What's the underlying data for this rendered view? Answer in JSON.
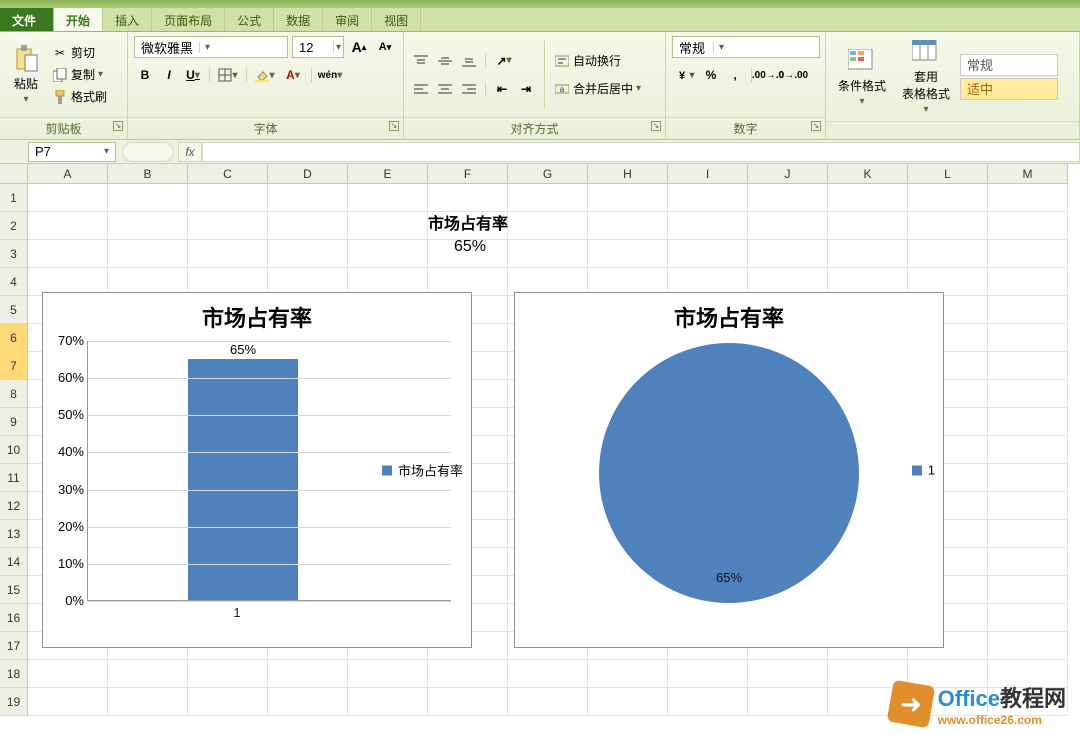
{
  "tabs": {
    "file": "文件",
    "home": "开始",
    "insert": "插入",
    "layout": "页面布局",
    "formula": "公式",
    "data": "数据",
    "review": "审阅",
    "view": "视图"
  },
  "ribbon": {
    "clipboard": {
      "paste": "粘贴",
      "cut": "剪切",
      "copy": "复制",
      "brush": "格式刷",
      "label": "剪贴板"
    },
    "font": {
      "name": "微软雅黑",
      "size": "12",
      "label": "字体"
    },
    "align": {
      "wrap": "自动换行",
      "merge": "合并后居中",
      "label": "对齐方式"
    },
    "number": {
      "format": "常规",
      "label": "数字"
    },
    "styles": {
      "cond": "条件格式",
      "table": "套用\n表格格式",
      "normal": "常规",
      "yellow": "适中"
    }
  },
  "namebox": "P7",
  "columns": [
    "A",
    "B",
    "C",
    "D",
    "E",
    "F",
    "G",
    "H",
    "I",
    "J",
    "K",
    "L",
    "M"
  ],
  "rows": [
    "1",
    "2",
    "3",
    "4",
    "5",
    "6",
    "7",
    "8",
    "9",
    "10",
    "11",
    "12",
    "13",
    "14",
    "15",
    "16",
    "17",
    "18",
    "19"
  ],
  "selected_rows": [
    6,
    7
  ],
  "celltext": {
    "title": "市场占有率",
    "value": "65%"
  },
  "chart_data": [
    {
      "type": "bar",
      "title": "市场占有率",
      "categories": [
        "1"
      ],
      "values": [
        65
      ],
      "ylabel": "",
      "ylim": [
        0,
        70
      ],
      "yticks": [
        0,
        10,
        20,
        30,
        40,
        50,
        60,
        70
      ],
      "data_labels": [
        "65%"
      ],
      "legend": [
        "市场占有率"
      ]
    },
    {
      "type": "pie",
      "title": "市场占有率",
      "series": [
        {
          "name": "1",
          "values": [
            65
          ]
        }
      ],
      "data_labels": [
        "65%"
      ],
      "legend": [
        "1"
      ]
    }
  ],
  "watermark": {
    "brand": "Office",
    "brand_cn": "教程网",
    "url": "www.office26.com"
  }
}
